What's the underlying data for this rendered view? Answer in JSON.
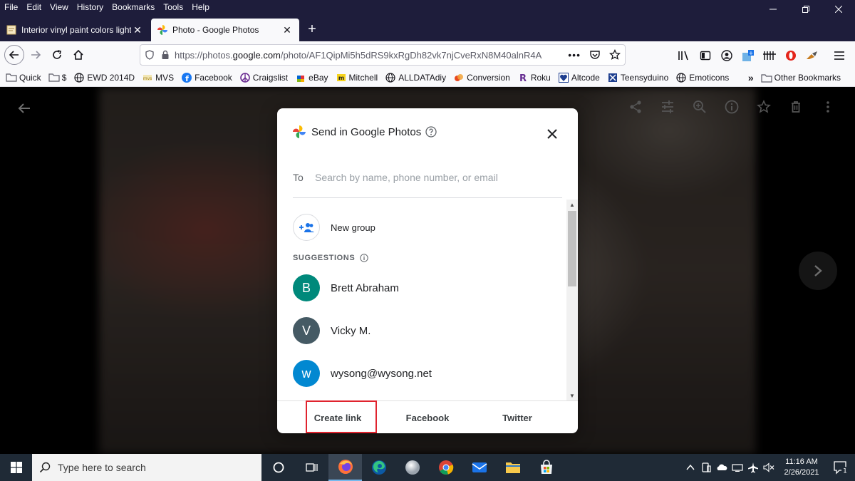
{
  "menubar": {
    "items": [
      "File",
      "Edit",
      "View",
      "History",
      "Bookmarks",
      "Tools",
      "Help"
    ]
  },
  "tabs": [
    {
      "title": "Interior vinyl paint colors light │",
      "icon": "document-icon"
    },
    {
      "title": "Photo - Google Photos",
      "icon": "google-photos-icon"
    }
  ],
  "navbar": {
    "url_prefix": "https://photos.",
    "url_domain": "google.com",
    "url_path": "/photo/AF1QipMi5h5dRS9kxRgDh82vk7njCveRxN8M40alnR4A"
  },
  "bookmarks": {
    "items": [
      "Quick",
      "$",
      "EWD 2014D",
      "MVS",
      "Facebook",
      "Craigslist",
      "eBay",
      "Mitchell",
      "ALLDATAdiy",
      "Conversion",
      "Roku",
      "Altcode",
      "Teensyduino",
      "Emoticons"
    ],
    "other": "Other Bookmarks"
  },
  "dialog": {
    "title": "Send in Google Photos",
    "to_label": "To",
    "to_placeholder": "Search by name, phone number, or email",
    "new_group": "New group",
    "suggestions_label": "SUGGESTIONS",
    "contacts": [
      {
        "initial": "B",
        "name": "Brett Abraham",
        "color": "#00897b"
      },
      {
        "initial": "V",
        "name": "Vicky M.",
        "color": "#455a64"
      },
      {
        "initial": "w",
        "name": "wysong@wysong.net",
        "color": "#0288d1"
      }
    ],
    "footer": {
      "create_link": "Create link",
      "facebook": "Facebook",
      "twitter": "Twitter"
    }
  },
  "taskbar": {
    "search_placeholder": "Type here to search",
    "time": "11:16 AM",
    "date": "2/26/2021",
    "notification_count": "1"
  },
  "colors": {
    "firefox_chrome": "#1e1d3b",
    "highlight_box": "#e0232e"
  }
}
